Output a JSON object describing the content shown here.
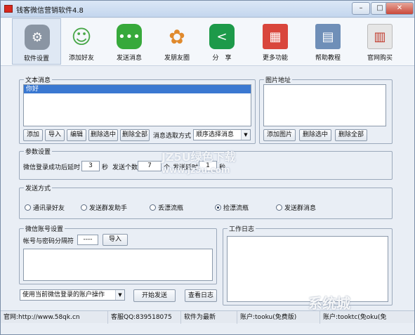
{
  "window": {
    "title": "钱客微信营销软件4.8",
    "min": "–",
    "max": "□",
    "close": "✕"
  },
  "toolbar": [
    {
      "label": "软件设置",
      "icon": "gear-icon",
      "color": "#8a95a3",
      "glyph": "⚙"
    },
    {
      "label": "添加好友",
      "icon": "add-friend-icon",
      "color": "#4aa84a",
      "glyph": "✚"
    },
    {
      "label": "发送消息",
      "icon": "chat-bubble-icon",
      "color": "#37a93b",
      "glyph": "…"
    },
    {
      "label": "发朋友圈",
      "icon": "moments-icon",
      "color": "#e08a2d",
      "glyph": "✿"
    },
    {
      "label": "分　享",
      "icon": "share-icon",
      "color": "#1d9a4a",
      "glyph": "<"
    },
    {
      "label": "更多功能",
      "icon": "more-functions-icon",
      "color": "#d9463c",
      "glyph": "▦"
    },
    {
      "label": "帮助教程",
      "icon": "help-icon",
      "color": "#6f8fb8",
      "glyph": "▤"
    },
    {
      "label": "官网购买",
      "icon": "buy-icon",
      "color": "#c9c9c9",
      "glyph": "▥"
    }
  ],
  "text_messages": {
    "title": "文本消息",
    "items": [
      "你好"
    ],
    "buttons": [
      "添加",
      "导入",
      "编辑",
      "删除选中",
      "删除全部"
    ],
    "mode_label": "消息选取方式",
    "mode_value": "顺序选择消息"
  },
  "images": {
    "title": "图片地址",
    "buttons": [
      "添加图片",
      "删除选中",
      "删除全部"
    ]
  },
  "params": {
    "title": "参数设置",
    "delay_label": "微信登录成功后延时",
    "delay_value": "3",
    "delay_unit": "秒",
    "count_label": "发送个数",
    "count_value": "7",
    "count_unit": "个",
    "interval_label": "发送延时",
    "interval_value": "1",
    "interval_unit": "秒"
  },
  "send_mode": {
    "title": "发送方式",
    "options": [
      "通讯录好友",
      "发送群发助手",
      "丢漂流瓶",
      "捡漂流瓶",
      "发送群消息"
    ],
    "selected": 3
  },
  "accounts": {
    "title": "微信账号设置",
    "sep_label": "帐号与密码分隔符",
    "sep_value": "----",
    "import": "导入"
  },
  "log": {
    "title": "工作日志"
  },
  "bottom": {
    "account_mode": "使用当前微信登录的账户操作",
    "start": "开始发送",
    "view_log": "查看日志"
  },
  "status": {
    "site": "官网:http://www.58qk.cn",
    "qq": "客服QQ:839518075",
    "version": "软件为最新",
    "account": "账户:tooku(免费版)",
    "extra": "账户:tooktc(免oku(免"
  },
  "watermark": {
    "top": "JZ5U绿色下载",
    "url": "www.jz5u.com",
    "corner": "系统城"
  }
}
